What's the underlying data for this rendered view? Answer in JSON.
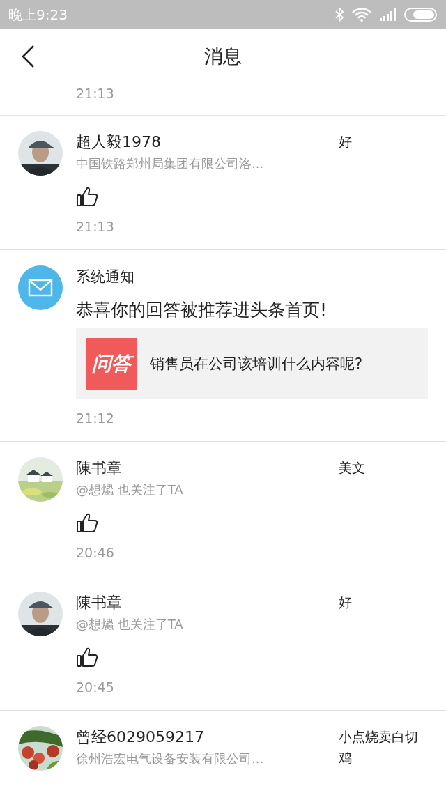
{
  "status_bar": {
    "time": "晚上9:23"
  },
  "header": {
    "title": "消息"
  },
  "messages": [
    {
      "kind": "partial",
      "time": "21:13"
    },
    {
      "kind": "like",
      "name": "超人毅1978",
      "subtitle": "中国铁路郑州局集团有限公司洛...",
      "reply": "好",
      "time": "21:13"
    },
    {
      "kind": "system",
      "title": "系统通知",
      "message": "恭喜你的回答被推荐进头条首页!",
      "card": {
        "badge": "问答",
        "question": "销售员在公司该培训什么内容呢?"
      },
      "time": "21:12"
    },
    {
      "kind": "like",
      "name": "陳书章",
      "subtitle": "@想爞 也关注了TA",
      "reply": "美文",
      "time": "20:46"
    },
    {
      "kind": "like",
      "name": "陳书章",
      "subtitle": "@想爞 也关注了TA",
      "reply": "好",
      "time": "20:45"
    },
    {
      "kind": "cut",
      "name": "曾经6029059217",
      "subtitle": "徐州浩宏电气设备安装有限公司...",
      "reply": "小点烧卖白切鸡"
    }
  ]
}
